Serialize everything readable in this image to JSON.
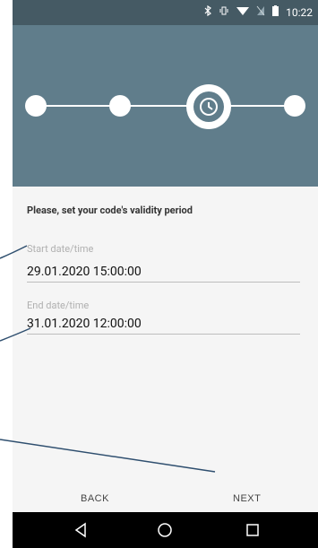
{
  "statusbar": {
    "time": "10:22",
    "icons": [
      "bluetooth-icon",
      "vibrate-icon",
      "wifi-icon",
      "no-sim-icon",
      "battery-icon"
    ]
  },
  "stepper": {
    "current_step": 3,
    "total_steps": 4,
    "current_icon": "clock-icon"
  },
  "form": {
    "prompt": "Please, set your code's validity period",
    "start_label": "Start date/time",
    "start_value": "29.01.2020 15:00:00",
    "end_label": "End date/time",
    "end_value": "31.01.2020 12:00:00"
  },
  "actions": {
    "back_label": "BACK",
    "next_label": "NEXT"
  },
  "colors": {
    "header_dark": "#455a64",
    "header": "#607d8b",
    "background": "#f5f5f5",
    "callout_line": "#2f4f6f"
  }
}
